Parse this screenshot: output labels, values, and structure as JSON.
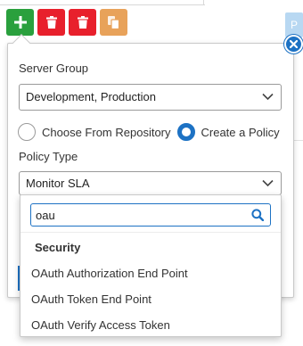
{
  "toolbar": {
    "add_icon": "plus-icon",
    "delete_icon": "trash-icon",
    "copy_icon": "copy-icon",
    "colors": {
      "add": "#2aa03d",
      "delete": "#e8202c",
      "copy": "#e8a25a"
    }
  },
  "background": {
    "right_button_label": "P"
  },
  "form": {
    "server_group_label": "Server Group",
    "server_group_value": "Development, Production",
    "radio_repository_label": "Choose From Repository",
    "radio_create_label": "Create a Policy",
    "selected_radio": "create",
    "policy_type_label": "Policy Type",
    "policy_type_value": "Monitor SLA"
  },
  "dropdown": {
    "search_value": "oau",
    "group_label": "Security",
    "options": [
      "OAuth Authorization End Point",
      "OAuth Token End Point",
      "OAuth Verify Access Token"
    ]
  },
  "accent_color": "#1d72c4"
}
